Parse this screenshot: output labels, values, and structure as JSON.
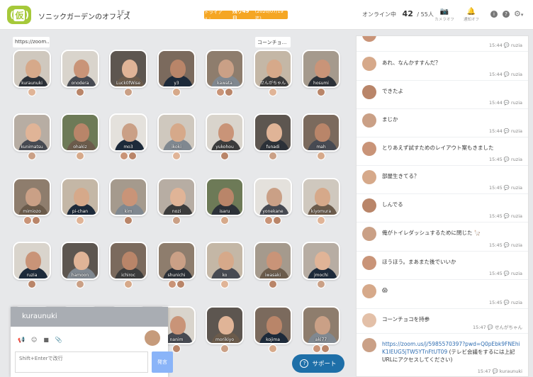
{
  "header": {
    "logo": "仮",
    "office_name": "ソニックガーデンのオフィス",
    "floor": "1F",
    "trial_label": "トライアル：",
    "trial_days": "残り49日",
    "trial_date": "(2020/07/19迄)",
    "online_label": "オンライン中",
    "online_count": "42",
    "online_total": "/ 55人",
    "camera_label": "カメラオフ",
    "notify_label": "通知オフ"
  },
  "tooltips": {
    "left": "https://zoom....",
    "right": "コーンチョ..."
  },
  "grid": {
    "people": [
      {
        "name": "kuraunuki"
      },
      {
        "name": "onodera"
      },
      {
        "name": "Luck0fWise"
      },
      {
        "name": "y3"
      },
      {
        "name": "kawata"
      },
      {
        "name": "せんがちゃん"
      },
      {
        "name": "hosumi"
      },
      {
        "name": "kunimatsu"
      },
      {
        "name": "ohakiz"
      },
      {
        "name": "mo3"
      },
      {
        "name": "ikoki"
      },
      {
        "name": "yukohou"
      },
      {
        "name": "funadi"
      },
      {
        "name": "mah"
      },
      {
        "name": "mimiozo"
      },
      {
        "name": "pi-chan"
      },
      {
        "name": "kim"
      },
      {
        "name": "nozi"
      },
      {
        "name": "isaru"
      },
      {
        "name": "yonekane"
      },
      {
        "name": "kiyomura"
      },
      {
        "name": "ruzia"
      },
      {
        "name": "hamoon"
      },
      {
        "name": "ichiroc"
      },
      {
        "name": "shunichi"
      },
      {
        "name": "ko"
      },
      {
        "name": "iwasaki"
      },
      {
        "name": "jmochi"
      },
      {
        "name": ""
      },
      {
        "name": ""
      },
      {
        "name": ""
      },
      {
        "name": "nanim"
      },
      {
        "name": "morikiyo"
      },
      {
        "name": "kojima"
      },
      {
        "name": "aki77"
      }
    ]
  },
  "mini_chat": {
    "title": "kuraunuki",
    "placeholder": "Shift+Enterで改行",
    "send_label": "発言"
  },
  "support_label": "サポート",
  "chat": {
    "messages": [
      {
        "text": "",
        "time": "15:44",
        "user": "ruzia"
      },
      {
        "text": "あれ、なんかすすんだ？",
        "time": "15:44",
        "user": "ruzia"
      },
      {
        "text": "できたよ",
        "time": "15:44",
        "user": "ruzia"
      },
      {
        "text": "まじか",
        "time": "15:44",
        "user": "ruzia"
      },
      {
        "text": "とりあえず試すためのレイアウト案もきました",
        "time": "15:45",
        "user": "ruzia"
      },
      {
        "text": "部屋生きてる？",
        "time": "15:45",
        "user": "ruzia"
      },
      {
        "text": "しんでる",
        "time": "15:45",
        "user": "ruzia"
      },
      {
        "text": "俺がトイレダッシュするために閉じた 🦙",
        "time": "15:45",
        "user": "ruzia"
      },
      {
        "text": "ほうほう。まあまた後でいいか",
        "time": "15:45",
        "user": "ruzia"
      },
      {
        "text": "😱",
        "time": "15:45",
        "user": "ruzia"
      },
      {
        "text": "コーンチョコを持参",
        "time": "15:47",
        "user": "せんがちゃん"
      },
      {
        "link": "https://zoom.us/j/5985570397?pwd=Q0pEbk9FNEhiK1lEUG5jTW5YTnFtUT09",
        "text": " (テレビ会議をするには上記URLにアクセスしてください)",
        "time": "15:47",
        "user": "kuraunuki"
      }
    ]
  },
  "colors": {
    "accent": "#a6c93a",
    "trial": "#f5a623",
    "support": "#1e6fa8",
    "link": "#2f6db1"
  }
}
